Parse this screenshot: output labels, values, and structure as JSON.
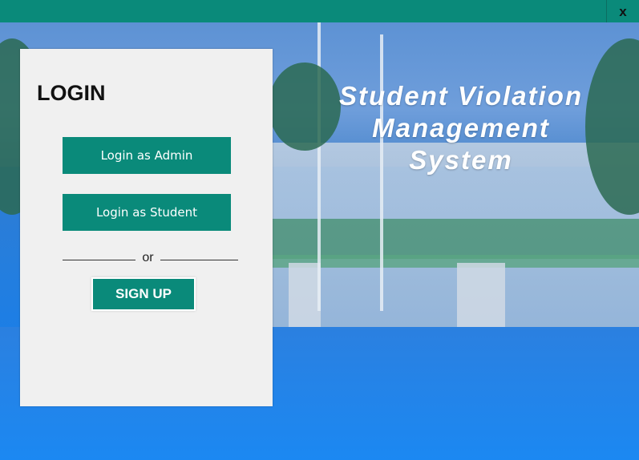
{
  "window": {
    "close_label": "x"
  },
  "app": {
    "title_line1": "Student Violation",
    "title_line2": "Management",
    "title_line3": "System"
  },
  "login_panel": {
    "heading": "LOGIN",
    "admin_button": "Login as Admin",
    "student_button": "Login as Student",
    "or_text": "or",
    "signup_button": "SIGN UP"
  },
  "colors": {
    "accent": "#0a8a7a",
    "panel": "#f0f0f0",
    "background_blue": "#1b86f0"
  }
}
